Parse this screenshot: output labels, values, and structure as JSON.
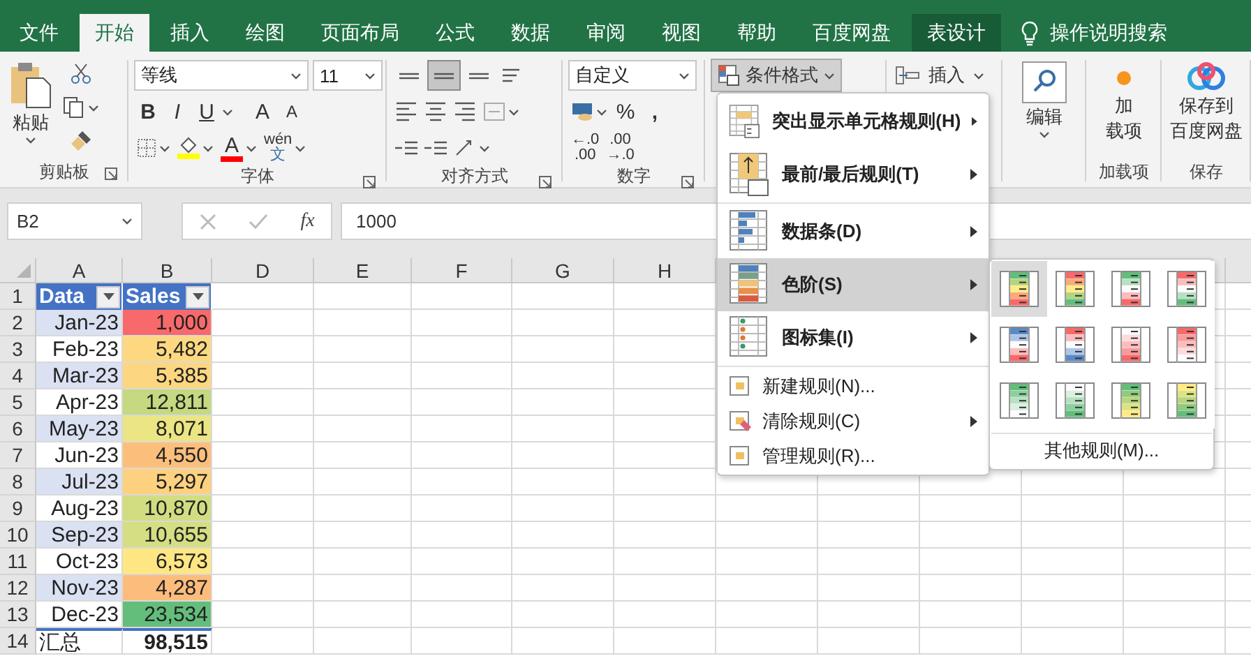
{
  "tabs": [
    {
      "label": "文件",
      "selected": false,
      "contextual": false
    },
    {
      "label": "开始",
      "selected": true,
      "contextual": false
    },
    {
      "label": "插入",
      "selected": false,
      "contextual": false
    },
    {
      "label": "绘图",
      "selected": false,
      "contextual": false
    },
    {
      "label": "页面布局",
      "selected": false,
      "contextual": false
    },
    {
      "label": "公式",
      "selected": false,
      "contextual": false
    },
    {
      "label": "数据",
      "selected": false,
      "contextual": false
    },
    {
      "label": "审阅",
      "selected": false,
      "contextual": false
    },
    {
      "label": "视图",
      "selected": false,
      "contextual": false
    },
    {
      "label": "帮助",
      "selected": false,
      "contextual": false
    },
    {
      "label": "百度网盘",
      "selected": false,
      "contextual": false
    },
    {
      "label": "表设计",
      "selected": false,
      "contextual": true
    }
  ],
  "tell_me": "操作说明搜索",
  "ribbon": {
    "clipboard": {
      "paste": "粘贴",
      "group": "剪贴板"
    },
    "font": {
      "group": "字体",
      "name": "等线",
      "size": "11",
      "styles": [
        "B",
        "I",
        "U"
      ],
      "grow": "A",
      "shrink": "A",
      "color_letter": "A",
      "phonetic": "wén",
      "phonetic_char": "文"
    },
    "alignment": {
      "group": "对齐方式",
      "vertical": [
        {
          "selected": false
        },
        {
          "selected": true
        },
        {
          "selected": false
        }
      ]
    },
    "number": {
      "group": "数字",
      "format": "自定义",
      "percent": "%",
      "comma": ",",
      "increase_decimal": [
        "←.0",
        ".00"
      ],
      "decrease_decimal": [
        ".00",
        "→.0"
      ]
    },
    "styles": {
      "conditional": "条件格式",
      "open": true
    },
    "cells": {
      "insert": "插入"
    },
    "editing": {
      "label": "编辑"
    },
    "addins": {
      "label": [
        "加",
        "载项"
      ],
      "group": "加载项"
    },
    "save": {
      "label": [
        "保存到",
        "百度网盘"
      ],
      "group": "保存"
    }
  },
  "formula_bar": {
    "name_box": "B2",
    "fx": "fx",
    "formula": "1000"
  },
  "sheet": {
    "columns": [
      "A",
      "B",
      "D",
      "E",
      "F",
      "G",
      "H"
    ],
    "row_numbers": [
      "1",
      "2",
      "3",
      "4",
      "5",
      "6",
      "7",
      "8",
      "9",
      "10",
      "11",
      "12",
      "13",
      "14"
    ],
    "headers": [
      "Data",
      "Sales"
    ],
    "rows": [
      {
        "date": "Jan-23",
        "sales": "1,000",
        "color": "#f8696b"
      },
      {
        "date": "Feb-23",
        "sales": "5,482",
        "color": "#fed880"
      },
      {
        "date": "Mar-23",
        "sales": "5,385",
        "color": "#fdd780"
      },
      {
        "date": "Apr-23",
        "sales": "12,811",
        "color": "#c4d980"
      },
      {
        "date": "May-23",
        "sales": "8,071",
        "color": "#ebe583"
      },
      {
        "date": "Jun-23",
        "sales": "4,550",
        "color": "#fcbf7b"
      },
      {
        "date": "Jul-23",
        "sales": "5,297",
        "color": "#fdd17f"
      },
      {
        "date": "Aug-23",
        "sales": "10,870",
        "color": "#d2dd81"
      },
      {
        "date": "Sep-23",
        "sales": "10,655",
        "color": "#d5de82"
      },
      {
        "date": "Oct-23",
        "sales": "6,573",
        "color": "#fee783"
      },
      {
        "date": "Nov-23",
        "sales": "4,287",
        "color": "#fcbc7b"
      },
      {
        "date": "Dec-23",
        "sales": "23,534",
        "color": "#63be7b"
      }
    ],
    "total": {
      "label": "汇总",
      "value": "98,515"
    }
  },
  "menu": {
    "items": [
      {
        "label": "突出显示单元格规则(H)",
        "kind": "large",
        "submenu": true,
        "selected": false
      },
      {
        "label": "最前/最后规则(T)",
        "kind": "large",
        "submenu": true,
        "selected": false
      },
      {
        "label": "数据条(D)",
        "kind": "large",
        "submenu": true,
        "selected": false
      },
      {
        "label": "色阶(S)",
        "kind": "large",
        "submenu": true,
        "selected": true
      },
      {
        "label": "图标集(I)",
        "kind": "large",
        "submenu": true,
        "selected": false
      },
      {
        "label": "新建规则(N)...",
        "kind": "small",
        "submenu": false,
        "selected": false
      },
      {
        "label": "清除规则(C)",
        "kind": "small",
        "submenu": true,
        "selected": false
      },
      {
        "label": "管理规则(R)...",
        "kind": "small",
        "submenu": false,
        "selected": false
      }
    ]
  },
  "submenu": {
    "swatches": [
      {
        "selected": true
      },
      {
        "selected": false
      },
      {
        "selected": false
      },
      {
        "selected": false
      },
      {
        "selected": false
      },
      {
        "selected": false
      },
      {
        "selected": false
      },
      {
        "selected": false
      },
      {
        "selected": false
      },
      {
        "selected": false
      },
      {
        "selected": false
      },
      {
        "selected": false
      }
    ],
    "more": "其他规则(M)..."
  }
}
